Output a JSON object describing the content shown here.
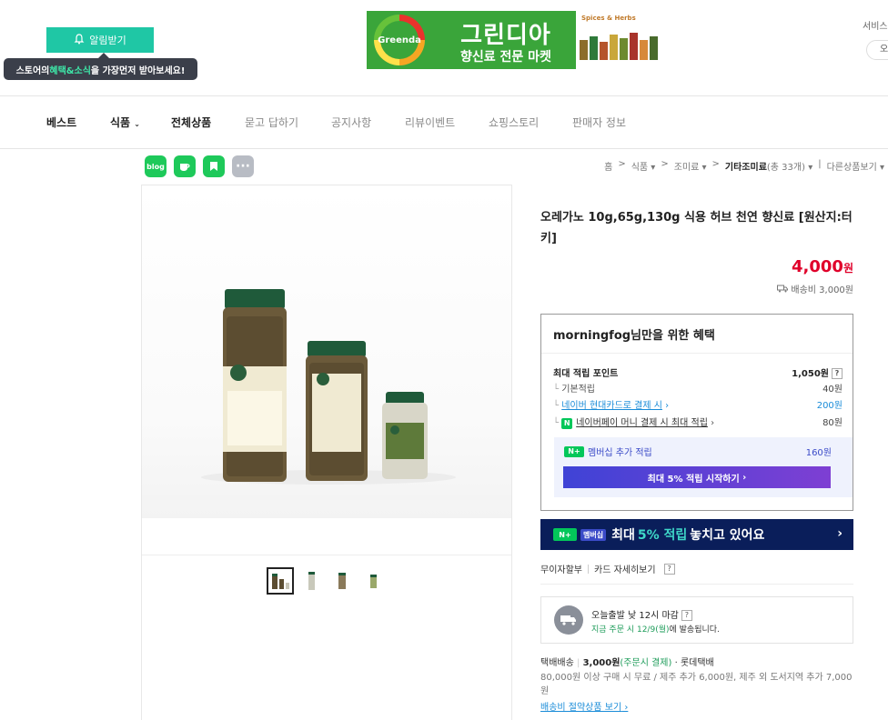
{
  "header": {
    "alarm_label": "알림받기",
    "tooltip_pre": "스토어의 ",
    "tooltip_hl": "혜택&소식",
    "tooltip_post": "을 가장먼저 받아보세요!",
    "banner_logo": "Greenda",
    "banner_title": "그린디아",
    "banner_sub": "향신료 전문 마켓",
    "banner_side": "Spices & Herbs",
    "service_label": "서비스",
    "service_pill": "오"
  },
  "nav": [
    "베스트",
    "식품",
    "전체상품",
    "묻고 답하기",
    "공지사항",
    "리뷰이벤트",
    "쇼핑스토리",
    "판매자 정보"
  ],
  "share": {
    "blog": "blog",
    "more": "···"
  },
  "breadcrumb": {
    "home": "홈",
    "c1": "식품",
    "c2": "조미료",
    "c3": "기타조미료",
    "count": "(총 33개)",
    "other": "다른상품보기"
  },
  "product": {
    "title": "오레가노 10g,65g,130g 식용 허브 천연 향신료 [원산지:터키]",
    "price": "4,000",
    "currency": "원",
    "shipping_fee": "배송비 3,000원"
  },
  "benefit": {
    "title": "morningfog님만을 위한 혜택",
    "max_points_label": "최대 적립 포인트",
    "max_points_value": "1,050원",
    "basic_label": "기본적립",
    "basic_value": "40원",
    "card_label": "네이버 현대카드로 결제 시",
    "card_value": "200원",
    "pay_label": "네이버페이 머니 결제 시 최대 적립",
    "pay_value": "80원",
    "member_label": "멤버십 추가 적립",
    "member_value": "160원",
    "member_btn": "최대 5% 적립 시작하기"
  },
  "promo": {
    "pre": "최대",
    "hl": "5% 적립",
    "post": "놓치고 있어요",
    "badge": "멤버십"
  },
  "card_links": {
    "installment": "무이자할부",
    "card_detail": "카드 자세히보기"
  },
  "delivery": {
    "deadline": "오늘출발 낮 12시 마감",
    "notice_hl": "지금 주문 시 12/9(월)",
    "notice_post": "에 발송됩니다."
  },
  "shipping": {
    "method": "택배배송",
    "fee": "3,000원",
    "timing": "(주문시 결제)",
    "carrier": "롯데택배",
    "note": "80,000원 이상 구매 시 무료 / 제주 추가 6,000원, 제주 외 도서지역 추가 7,000원",
    "save_link": "배송비 절약상품 보기"
  },
  "colors": {
    "accent": "#1fc7a5",
    "price": "#e0002a",
    "naver": "#03c75a",
    "promo_bg": "#0a1e5a"
  }
}
